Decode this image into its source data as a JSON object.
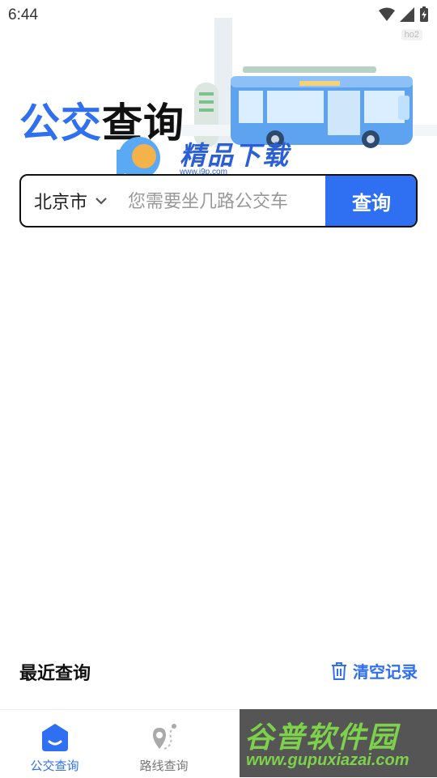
{
  "status_bar": {
    "time": "6:44"
  },
  "hero": {
    "title_accent": "公交",
    "title_main": "查询",
    "badge": "ho2"
  },
  "watermark_top": {
    "text": "精品下载",
    "url": "www.j9p.com"
  },
  "search": {
    "city": "北京市",
    "placeholder": "您需要坐几路公交车",
    "button_label": "查询"
  },
  "recent": {
    "title": "最近查询",
    "clear_label": "清空记录"
  },
  "bottom_nav": {
    "items": [
      {
        "label": "公交查询",
        "active": true
      },
      {
        "label": "路线查询",
        "active": false
      }
    ]
  },
  "watermark_bottom": {
    "text": "谷普软件园",
    "url": "www.gupuxiazai.com"
  },
  "colors": {
    "accent": "#2f6ff2",
    "text": "#111111",
    "muted": "#777777"
  }
}
